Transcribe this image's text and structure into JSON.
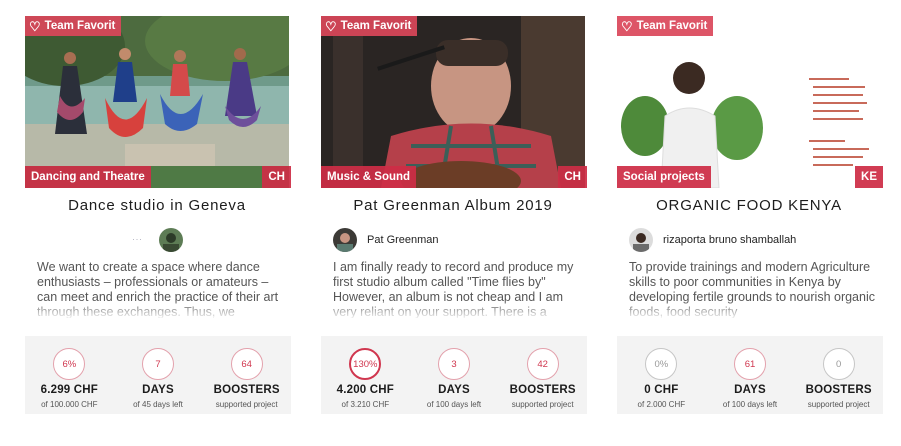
{
  "cards": [
    {
      "badge": "Team Favorit",
      "category": "Dancing and Theatre",
      "country": "CH",
      "title": "Dance studio in Geneva",
      "author": "",
      "description": "We want to create a space where dance enthusiasts – professionals or amateurs – can meet and enrich the practice of their art through these exchanges. Thus, we",
      "stats": [
        {
          "ring": "6%",
          "value": "6.299 CHF",
          "sub": "of 100.000 CHF"
        },
        {
          "ring": "7",
          "value": "DAYS",
          "sub": "of 45 days left"
        },
        {
          "ring": "64",
          "value": "BOOSTERS",
          "sub": "supported project"
        }
      ]
    },
    {
      "badge": "Team Favorit",
      "category": "Music & Sound",
      "country": "CH",
      "title": "Pat Greenman Album 2019",
      "author": "Pat Greenman",
      "description": "I am finally ready to record and produce my first studio album called \"Time flies by\" However, an album is not cheap and I am very reliant on your support. There is a",
      "stats": [
        {
          "ring": "130%",
          "value": "4.200 CHF",
          "sub": "of 3.210 CHF"
        },
        {
          "ring": "3",
          "value": "DAYS",
          "sub": "of 100 days left"
        },
        {
          "ring": "42",
          "value": "BOOSTERS",
          "sub": "supported project"
        }
      ]
    },
    {
      "badge": "Team Favorit",
      "category": "Social projects",
      "country": "KE",
      "title": "ORGANIC FOOD KENYA",
      "author": "rizaporta bruno shamballah",
      "description": "To provide trainings and modern Agriculture skills to poor communities in Kenya by developing fertile grounds to nourish organic foods, food security",
      "stats": [
        {
          "ring": "0%",
          "value": "0 CHF",
          "sub": "of 2.000 CHF"
        },
        {
          "ring": "61",
          "value": "DAYS",
          "sub": "of 100 days left"
        },
        {
          "ring": "0",
          "value": "BOOSTERS",
          "sub": "supported project"
        }
      ]
    }
  ],
  "icons": {
    "badge": "heart-outline-icon"
  },
  "colors": {
    "accent": "#d0374f",
    "badge_bg": "#da465a",
    "stats_bg": "#f3f3f3"
  }
}
